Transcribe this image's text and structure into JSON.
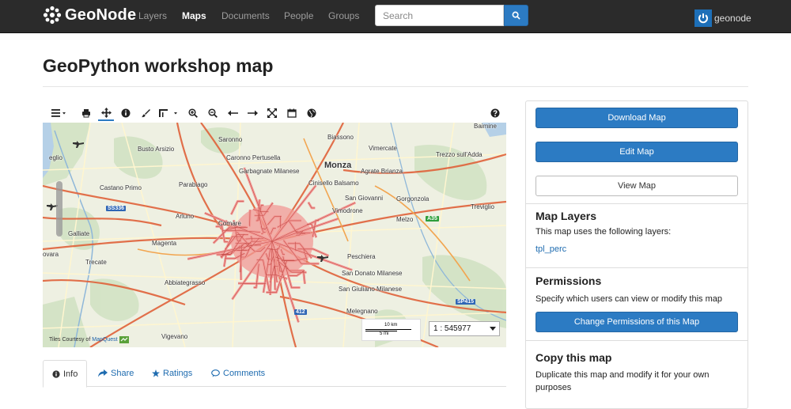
{
  "brand": {
    "name": "GeoNode"
  },
  "nav": {
    "layers": "Layers",
    "maps": "Maps",
    "documents": "Documents",
    "people": "People",
    "groups": "Groups"
  },
  "search": {
    "placeholder": "Search"
  },
  "user": {
    "name": "geonode"
  },
  "page": {
    "title": "GeoPython workshop map"
  },
  "map": {
    "places": {
      "baimine": "Baimine",
      "saronno": "Saronno",
      "busto": "Busto Arsizio",
      "biassono": "Biassono",
      "vimercate": "Vimercate",
      "trezzo": "Trezzo sull'Adda",
      "caronno": "Caronno Pertusella",
      "garbagnate": "Garbagnate Milanese",
      "monza": "Monza",
      "agrate": "Agrate Brianza",
      "cinisello": "Cinisello Balsamo",
      "castano": "Castano Primo",
      "parabiago": "Parabiago",
      "sangiovanni": "San Giovanni",
      "gorgonzola": "Gorgonzola",
      "treviglio": "Treviglio",
      "vimodrone": "Vimodrone",
      "arluno": "Arluno",
      "melzo": "Melzo",
      "cornaredo": "Cornare",
      "galliate": "Galliate",
      "magenta": "Magenta",
      "novara": "ovara",
      "trecate": "Trecate",
      "peschiera": "Peschiera",
      "abbiategrasso": "Abbiategrasso",
      "sandonato": "San Donato Milanese",
      "sangiuliano": "San Giuliano Milanese",
      "melegnano": "Melegnano",
      "vigevano": "Vigevano",
      "seveso": "eglio"
    },
    "shields": {
      "ss336": "SS336",
      "a35": "A35",
      "sp415": "SP415",
      "a12": "412"
    },
    "scale": {
      "km": "10 km",
      "mi": "5 mi",
      "ratio": "1 : 545977"
    },
    "attribution": {
      "text": "Tiles Courtesy of",
      "link": "MapQuest"
    }
  },
  "tabs": {
    "info": "Info",
    "share": "Share",
    "ratings": "Ratings",
    "comments": "Comments"
  },
  "sidebar": {
    "download": "Download Map",
    "edit": "Edit Map",
    "view": "View Map",
    "layers_title": "Map Layers",
    "layers_desc": "This map uses the following layers:",
    "layer_name": "tpl_perc",
    "perm_title": "Permissions",
    "perm_desc": "Specify which users can view or modify this map",
    "perm_button": "Change Permissions of this Map",
    "copy_title": "Copy this map",
    "copy_desc": "Duplicate this map and modify it for your own purposes"
  },
  "colors": {
    "navbar": "#2b2b2b",
    "primary": "#2c7bc3",
    "link": "#1f6cb0",
    "route": "#f29a96"
  }
}
